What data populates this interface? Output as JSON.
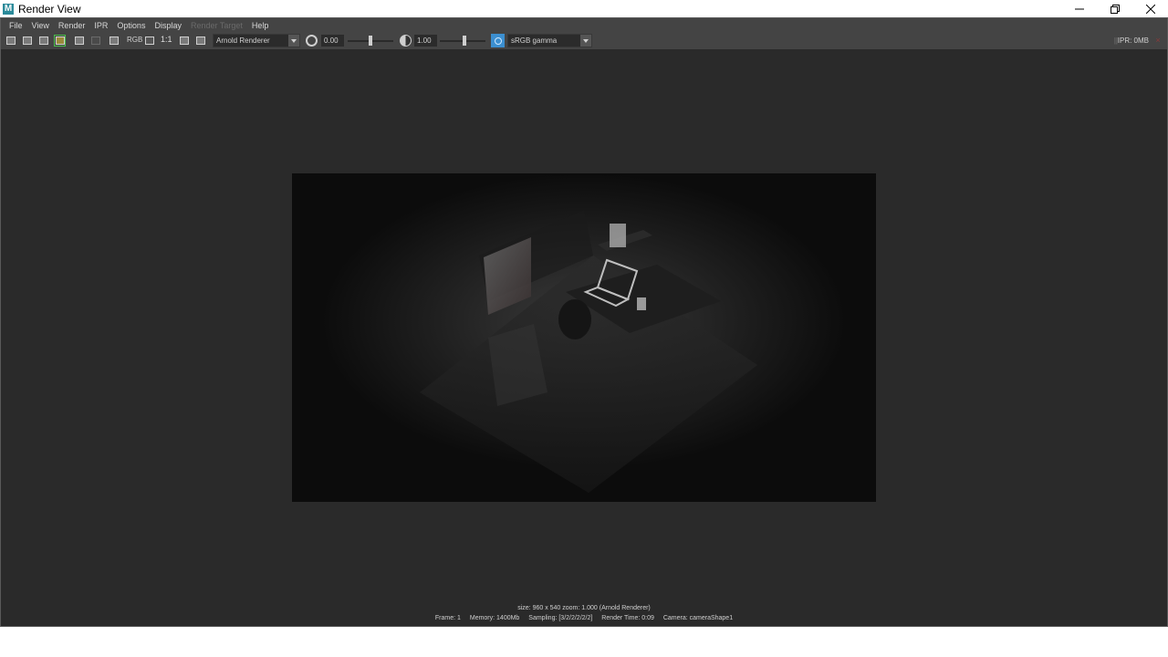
{
  "window": {
    "title": "Render View",
    "logo": "M"
  },
  "menu": {
    "items": [
      "File",
      "View",
      "Render",
      "IPR",
      "Options",
      "Display",
      "Render Target",
      "Help"
    ]
  },
  "toolbar": {
    "ratio_label": "1:1",
    "rgb_label": "RGB",
    "renderer": "Arnold Renderer",
    "exposure": "0.00",
    "gamma": "1.00",
    "color_space": "sRGB gamma",
    "exposure_level": 0.5,
    "gamma_level": 0.55,
    "ipr_status": "IPR: 0MB"
  },
  "status": {
    "size_line": "size: 960 x 540 zoom: 1.000     (Arnold Renderer)",
    "frame": "Frame: 1",
    "memory": "Memory: 1400Mb",
    "sampling": "Sampling: [3/2/2/2/2/2]",
    "render_time": "Render Time: 0:09",
    "camera": "Camera: cameraShape1"
  },
  "colors": {
    "ui_bg": "#444444",
    "viewport_bg": "#2a2a2a",
    "active_green": "#4bbf4b",
    "accent_blue": "#3c8fd0"
  }
}
